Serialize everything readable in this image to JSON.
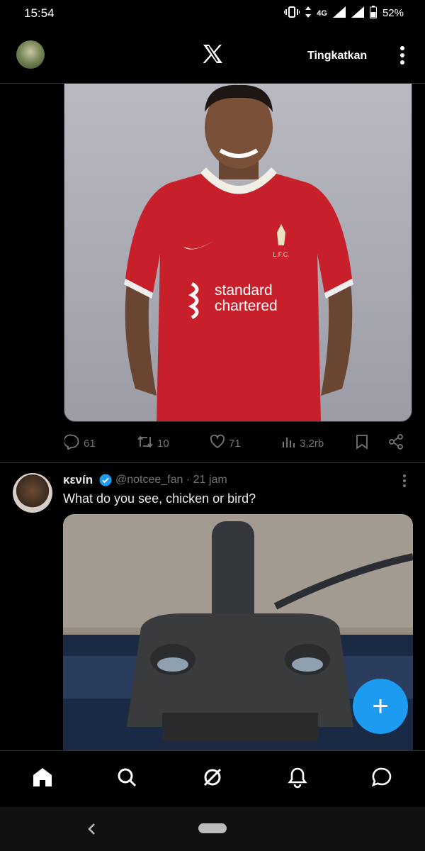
{
  "status_bar": {
    "time": "15:54",
    "network": "4G",
    "battery": "52%"
  },
  "header": {
    "upgrade_label": "Tingkatkan",
    "logo": "x-logo-icon",
    "menu_icon": "more-vert-icon"
  },
  "tweet1": {
    "image_alt": "Player in red jersey",
    "jersey_text": [
      "standard",
      "chartered"
    ],
    "club_badge": "L.F.C.",
    "actions": {
      "replies": "61",
      "retweets": "10",
      "likes": "71",
      "views": "3,2rb"
    }
  },
  "tweet2": {
    "name": "κενín",
    "handle_time": "@notcee_fan · 21 jam",
    "text": "What do you see, chicken or bird?",
    "verified": true
  },
  "fab": {
    "label": "+"
  },
  "bottom_nav": [
    "home-icon",
    "search-icon",
    "grok-icon",
    "notifications-icon",
    "messages-icon"
  ],
  "colors": {
    "accent": "#1d9bf0",
    "background": "#000000",
    "muted": "#71767b",
    "text": "#e7e9ea"
  }
}
